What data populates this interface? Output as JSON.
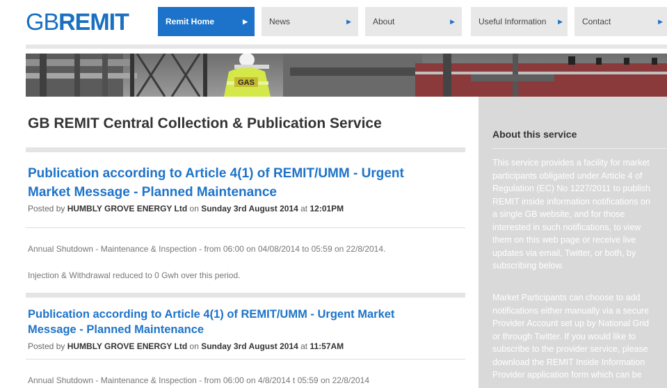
{
  "header": {
    "logo_gb": "GB",
    "logo_remit": "REMIT"
  },
  "nav": [
    {
      "label": "Remit Home",
      "active": true
    },
    {
      "label": "News",
      "active": false
    },
    {
      "label": "About",
      "active": false
    },
    {
      "label": "Useful Information",
      "active": false
    },
    {
      "label": "Contact",
      "active": false
    }
  ],
  "banner": {
    "badge_text": "GAS"
  },
  "main": {
    "title": "GB REMIT Central Collection & Publication Service",
    "posts": [
      {
        "title": "Publication according to Article 4(1) of REMIT/UMM - Urgent Market Message - Planned Maintenance",
        "title_line1": "Publication according to Article 4(1) of REMIT/UMM - Urgent",
        "title_line2": "Market Message - Planned Maintenance",
        "posted_by_prefix": "Posted by ",
        "author": "HUMBLY GROVE ENERGY Ltd",
        "on_text": " on ",
        "date": "Sunday 3rd August 2014",
        "at_text": " at ",
        "time": "12:01PM",
        "body": [
          "Annual Shutdown - Maintenance & Inspection - from 06:00 on 04/08/2014 to 05:59 on 22/8/2014.",
          "Injection & Withdrawal reduced to 0 Gwh over this period."
        ]
      },
      {
        "title": "Publication according to Article 4(1) of REMIT/UMM - Urgent Market Message - Planned Maintenance",
        "title_line1": "Publication according to Article 4(1) of REMIT/UMM - Urgent Market",
        "title_line2": "Message - Planned Maintenance",
        "posted_by_prefix": "Posted by ",
        "author": "HUMBLY GROVE ENERGY Ltd",
        "on_text": " on ",
        "date": "Sunday 3rd August 2014",
        "at_text": " at ",
        "time": "11:57AM",
        "body": [
          "Annual Shutdown - Maintenance & Inspection - from 06:00 on 4/8/2014 t 05:59 on 22/8/2014"
        ]
      }
    ]
  },
  "sidebar": {
    "title": "About this service",
    "paragraph1_lines": [
      "This service provides a facility for market",
      "participants obligated under Article 4 of",
      "Regulation (EC) No 1227/2011 to publish",
      "REMIT inside information notifications on",
      "a single GB website, and for those",
      "interested in such notifications, to view",
      "them on this web page or receive live",
      "updates via email, Twitter, or both, by",
      "subscribing below."
    ],
    "paragraph2_lines": [
      "Market Participants can choose to add",
      "notifications either manually via a secure",
      "Provider Account set up by National Grid",
      "or through Twitter. If you would like to",
      "subscribe to the provider service, please",
      "download the REMIT Inside Information",
      "Provider application form which can be"
    ]
  },
  "colors": {
    "brand_blue": "#1d73c9",
    "nav_bg": "#e8e8e8",
    "sidebar_bg": "#d9d9d9"
  }
}
